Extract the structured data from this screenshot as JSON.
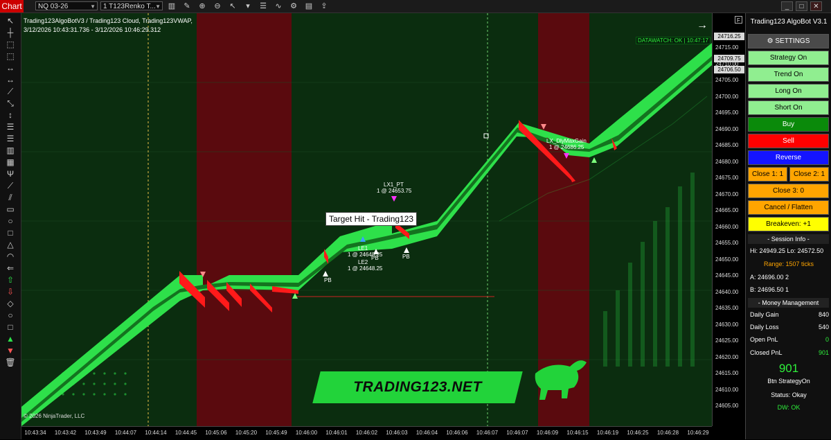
{
  "toolbar": {
    "chart_tab": "Chart",
    "instrument": "NQ 03-26",
    "bar_type": "1 T123Renko T..."
  },
  "chart": {
    "info_line1": "Trading123AlgoBotV3 / Trading123 Cloud, Trading123VWAP,",
    "info_line2": "3/12/2026 10:43:31.736 - 3/12/2026 10:46:29.312",
    "datawatch": "DATAWATCH: OK | 10:47:17",
    "copyright": "© 2026 NinjaTrader, LLC",
    "brand": "TRADING123.NET",
    "tooltip": "Target Hit - Trading123",
    "annotations": {
      "lx1_pt": "LX1_PT",
      "lx1_price": "1 @ 24653.75",
      "le1": "LE1",
      "le1_price": "1 @ 24648.25",
      "le2": "LE2",
      "le2_price": "1 @ 24648.25",
      "pb": "PB",
      "lx_dly": "LX_DlyMaxGain",
      "lx_dly_price": "1 @ 24686.25"
    }
  },
  "price_axis": {
    "badges": [
      "24716.25",
      "24709.75",
      "24706.50"
    ],
    "ticks": [
      "24715.00",
      "24710.00",
      "24705.00",
      "24700.00",
      "24695.00",
      "24690.00",
      "24685.00",
      "24680.00",
      "24675.00",
      "24670.00",
      "24665.00",
      "24660.00",
      "24655.00",
      "24650.00",
      "24645.00",
      "24640.00",
      "24635.00",
      "24630.00",
      "24625.00",
      "24620.00",
      "24615.00",
      "24610.00",
      "24605.00"
    ],
    "f_label": "F"
  },
  "time_axis": {
    "ticks": [
      "10:43:34",
      "10:43:42",
      "10:43:49",
      "10:44:07",
      "10:44:14",
      "10:44:45",
      "10:45:06",
      "10:45:20",
      "10:45:49",
      "10:46:00",
      "10:46:01",
      "10:46:02",
      "10:46:03",
      "10:46:04",
      "10:46:06",
      "10:46:07",
      "10:46:07",
      "10:46:09",
      "10:46:15",
      "10:46:19",
      "10:46:25",
      "10:46:28",
      "10:46:29"
    ]
  },
  "panel": {
    "title": "Trading123 AlgoBot V3.1",
    "settings": "SETTINGS",
    "strategy_on": "Strategy On",
    "trend_on": "Trend On",
    "long_on": "Long On",
    "short_on": "Short On",
    "buy": "Buy",
    "sell": "Sell",
    "reverse": "Reverse",
    "close1": "Close 1:  1",
    "close2": "Close 2:  1",
    "close3": "Close 3:  0",
    "cancel_flatten": "Cancel / Flatten",
    "breakeven": "Breakeven:  +1",
    "session_info": "Session Info",
    "hi_lo": "Hi: 24949.25  Lo: 24572.50",
    "range": "Range: 1507 ticks",
    "a_line": "A: 24696.00   2",
    "b_line": "B: 24696.50   1",
    "money_mgmt": "Money Management",
    "daily_gain_label": "Daily Gain",
    "daily_gain": "840",
    "daily_loss_label": "Daily Loss",
    "daily_loss": "540",
    "open_pnl_label": "Open PnL",
    "open_pnl": "0",
    "closed_pnl_label": "Closed PnL",
    "closed_pnl": "901",
    "big_value": "901",
    "btn_strategy": "Btn StrategyOn",
    "status": "Status: Okay",
    "dw": "DW: OK"
  },
  "colors": {
    "bg_green": "#0b2d0f",
    "band_red": "#5a0a0e",
    "bar_green": "#2ee04a",
    "bar_red": "#ff1a1a",
    "accent_green": "#22d33a"
  }
}
